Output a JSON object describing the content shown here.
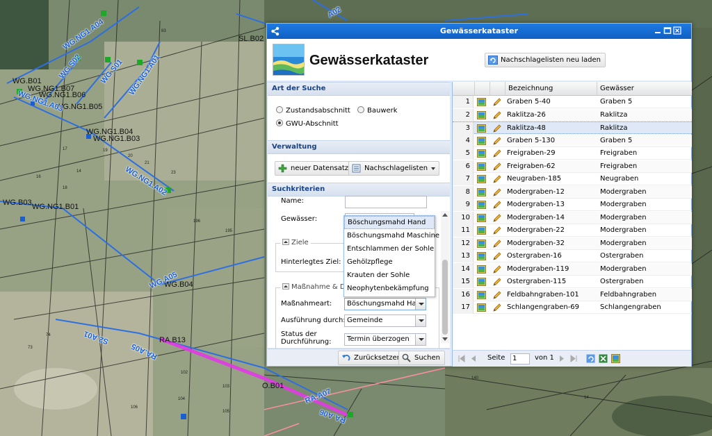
{
  "map": {
    "black_labels": [
      "SL.B02",
      "WG.B01",
      "WG.NG1.B07",
      "WG.NG1.B06",
      "WG.NG1.B05",
      "WG.NG1.B04",
      "WG.NG1.B03",
      "WG.B03",
      "WG.NG1.B01",
      "WG.B04",
      "RA.B13",
      "O.B01"
    ],
    "blue_labels": [
      "WG.NG1.A04",
      "WG S02",
      "WG S01",
      "WG.NG1.A01",
      "WG.NG1.A03",
      "WG.NG1.A02",
      "WG.A05",
      "S2.A01",
      "RA.A05",
      "RA.A07",
      "RA.A06",
      "A02"
    ],
    "parcel_numbers": [
      "83",
      "17",
      "19",
      "20",
      "21",
      "23",
      "16",
      "18",
      "14",
      "196",
      "195",
      "74",
      "73",
      "102",
      "103",
      "104",
      "105",
      "106",
      "140",
      "14"
    ]
  },
  "window": {
    "title": "Gewässerkataster",
    "app_title": "Gewässerkataster",
    "reload_label": "Nachschlagelisten neu laden"
  },
  "left": {
    "search_type_title": "Art der Suche",
    "radios": [
      {
        "label": "Zustandsabschnitt",
        "checked": false
      },
      {
        "label": "Bauwerk",
        "checked": false
      },
      {
        "label": "GWU-Abschnitt",
        "checked": true
      }
    ],
    "admin_title": "Verwaltung",
    "new_record_label": "neuer Datensatz",
    "lookup_lists_label": "Nachschlagelisten",
    "criteria_title": "Suchkriterien",
    "name_label": "Name:",
    "water_label": "Gewässer:",
    "goals_legend": "Ziele",
    "stored_goal_label": "Hinterlegtes Ziel:",
    "measure_legend": "Maßnahme & Dur",
    "measure_type_label": "Maßnahmeart:",
    "measure_type_value": "Böschungsmahd Han",
    "execution_label": "Ausführung durch:",
    "execution_value": "Gemeinde",
    "status_label_1": "Status der",
    "status_label_2": "Durchführung:",
    "status_value": "Termin überzogen",
    "reset_label": "Zurücksetzen",
    "search_label": "Suchen"
  },
  "dropdown": {
    "options": [
      "Böschungsmahd Hand",
      "Böschungsmahd Maschine",
      "Entschlammen der Sohle",
      "Gehölzpflege",
      "Krauten der Sohle",
      "Neophytenbekämpfung"
    ],
    "selected": "Böschungsmahd Hand"
  },
  "grid": {
    "columns": [
      "Bezeichnung",
      "Gewässer"
    ],
    "rows": [
      {
        "n": "1",
        "bez": "Graben 5-40",
        "gew": "Graben 5"
      },
      {
        "n": "2",
        "bez": "Raklitza-26",
        "gew": "Raklitza"
      },
      {
        "n": "3",
        "bez": "Raklitza-48",
        "gew": "Raklitza"
      },
      {
        "n": "4",
        "bez": "Graben 5-130",
        "gew": "Graben 5"
      },
      {
        "n": "5",
        "bez": "Freigraben-29",
        "gew": "Freigraben"
      },
      {
        "n": "6",
        "bez": "Freigraben-62",
        "gew": "Freigraben"
      },
      {
        "n": "7",
        "bez": "Neugraben-185",
        "gew": "Neugraben"
      },
      {
        "n": "8",
        "bez": "Modergraben-12",
        "gew": "Modergraben"
      },
      {
        "n": "9",
        "bez": "Modergraben-13",
        "gew": "Modergraben"
      },
      {
        "n": "10",
        "bez": "Modergraben-14",
        "gew": "Modergraben"
      },
      {
        "n": "11",
        "bez": "Modergraben-22",
        "gew": "Modergraben"
      },
      {
        "n": "12",
        "bez": "Modergraben-32",
        "gew": "Modergraben"
      },
      {
        "n": "13",
        "bez": "Ostergraben-16",
        "gew": "Ostergraben"
      },
      {
        "n": "14",
        "bez": "Modergraben-119",
        "gew": "Modergraben"
      },
      {
        "n": "15",
        "bez": "Ostergraben-115",
        "gew": "Ostergraben"
      },
      {
        "n": "16",
        "bez": "Feldbahngraben-101",
        "gew": "Feldbahngraben"
      },
      {
        "n": "17",
        "bez": "Schlangengraben-69",
        "gew": "Schlangengraben"
      }
    ],
    "selected_row": "3"
  },
  "pager": {
    "page_label": "Seite",
    "page_value": "1",
    "of_label": "von 1"
  },
  "colors": {
    "title_bar": "#1e7ae1",
    "panel_header_text": "#15428b",
    "selection": "#dfe8f6",
    "map_blue": "#1a5fd1",
    "map_magenta": "#e23ae6"
  }
}
